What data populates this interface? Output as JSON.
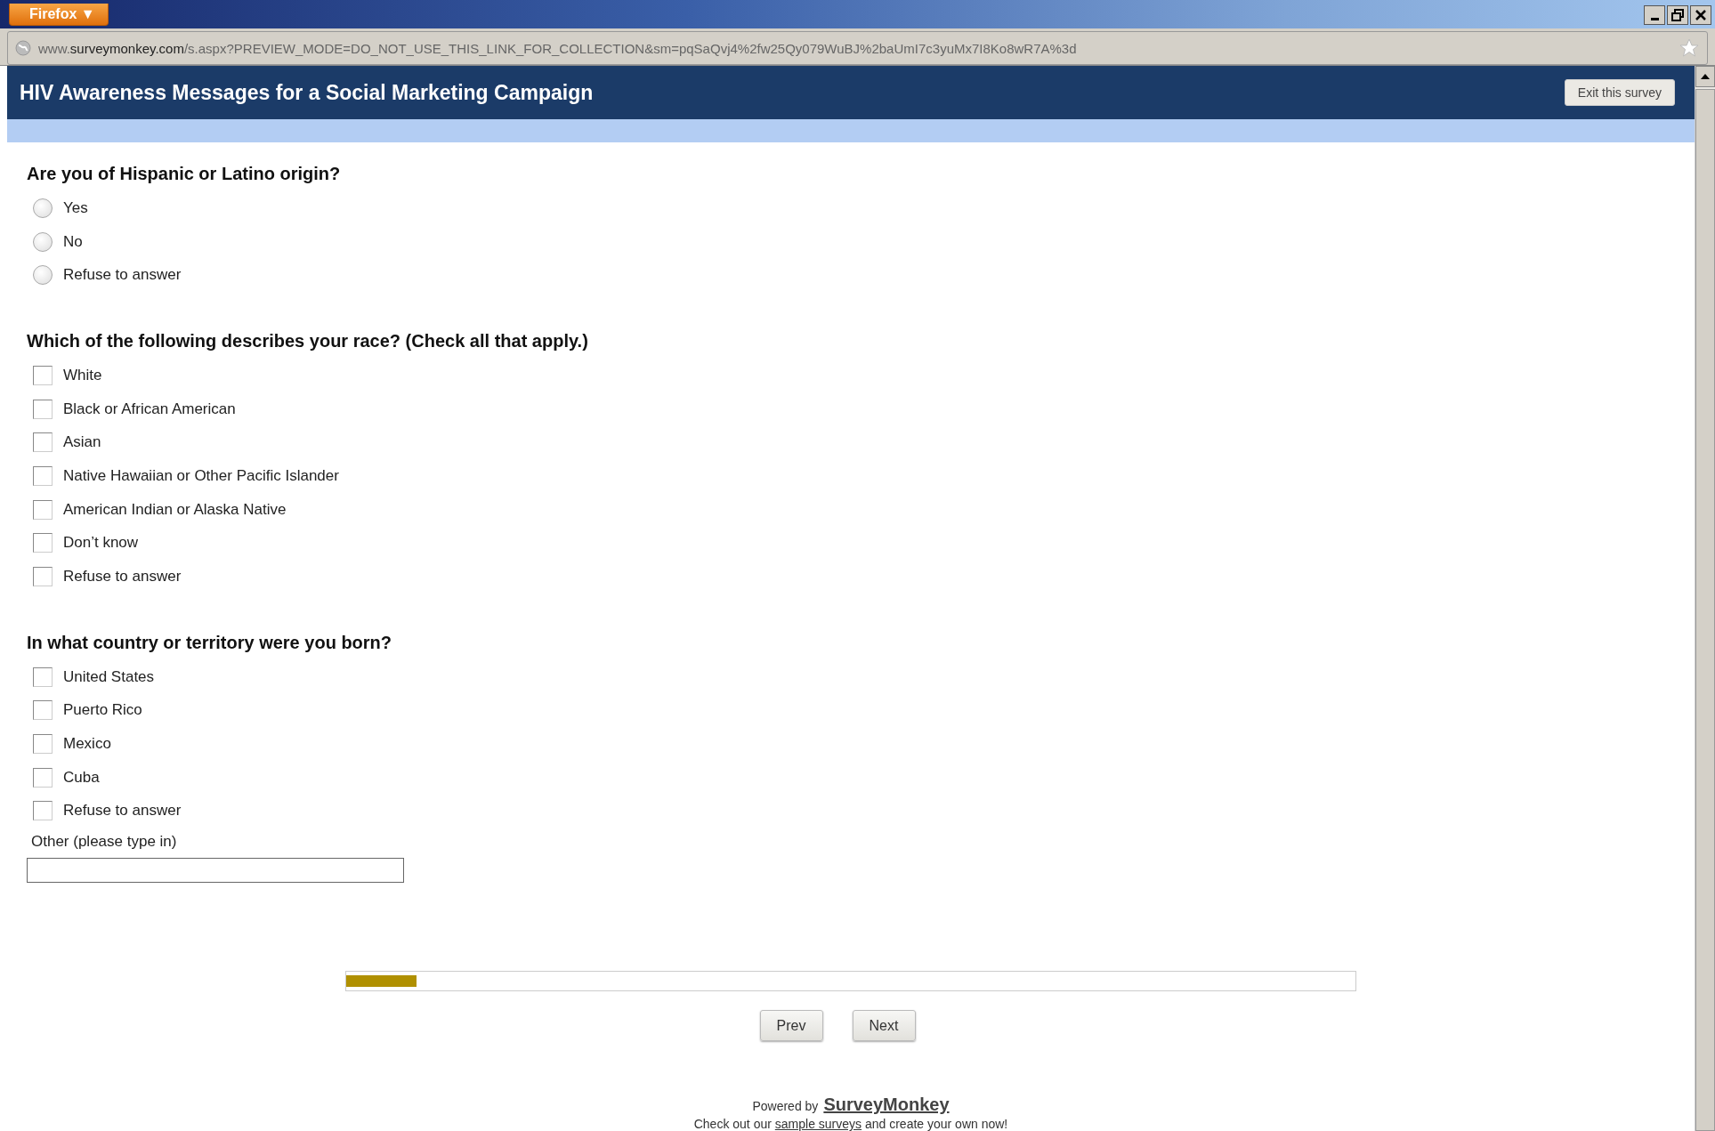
{
  "browser": {
    "menu_button": "Firefox ▼",
    "url": "www.**surveymonkey.com**/s.aspx?PREVIEW_MODE=DO_NOT_USE_THIS_LINK_FOR_COLLECTION&sm=pqSaQvj4%2fw25Qy079WuBJ%2baUmI7c3yuMx7I8Ko8wR7A%3d"
  },
  "header": {
    "title": "HIV Awareness Messages for a Social Marketing Campaign",
    "exit_button": "Exit this survey"
  },
  "questions": [
    {
      "kind": "radio",
      "text": "Are you of Hispanic or Latino origin?",
      "options": [
        {
          "label": "Yes",
          "selected": false
        },
        {
          "label": "No",
          "selected": false
        },
        {
          "label": "Refuse to answer",
          "selected": false
        }
      ]
    },
    {
      "kind": "checkbox",
      "text": "Which of the following describes your race? (Check all that apply.)",
      "options": [
        {
          "label": "White",
          "checked": false
        },
        {
          "label": "Black or African American",
          "checked": false
        },
        {
          "label": "Asian",
          "checked": false
        },
        {
          "label": "Native Hawaiian or Other Pacific Islander",
          "checked": false
        },
        {
          "label": "American Indian or Alaska Native",
          "checked": false
        },
        {
          "label": "Don’t know",
          "checked": false
        },
        {
          "label": "Refuse to answer",
          "checked": false
        }
      ]
    },
    {
      "kind": "checkbox",
      "text": "In what country or territory were you born?",
      "options": [
        {
          "label": "United States",
          "checked": false
        },
        {
          "label": "Puerto Rico",
          "checked": false
        },
        {
          "label": "Mexico",
          "checked": false
        },
        {
          "label": "Cuba",
          "checked": false
        },
        {
          "label": "Refuse to answer",
          "checked": false
        }
      ],
      "other_label": "Other (please type in)"
    }
  ],
  "progress": {
    "level": 0.07
  },
  "buttons": [
    "Prev",
    "Next"
  ],
  "footer": {
    "powered_by": "Powered by",
    "brand_link": "SurveyMonkey",
    "note_before": "Check out our",
    "note_link": "sample surveys",
    "note_after": "and create your own now!"
  }
}
